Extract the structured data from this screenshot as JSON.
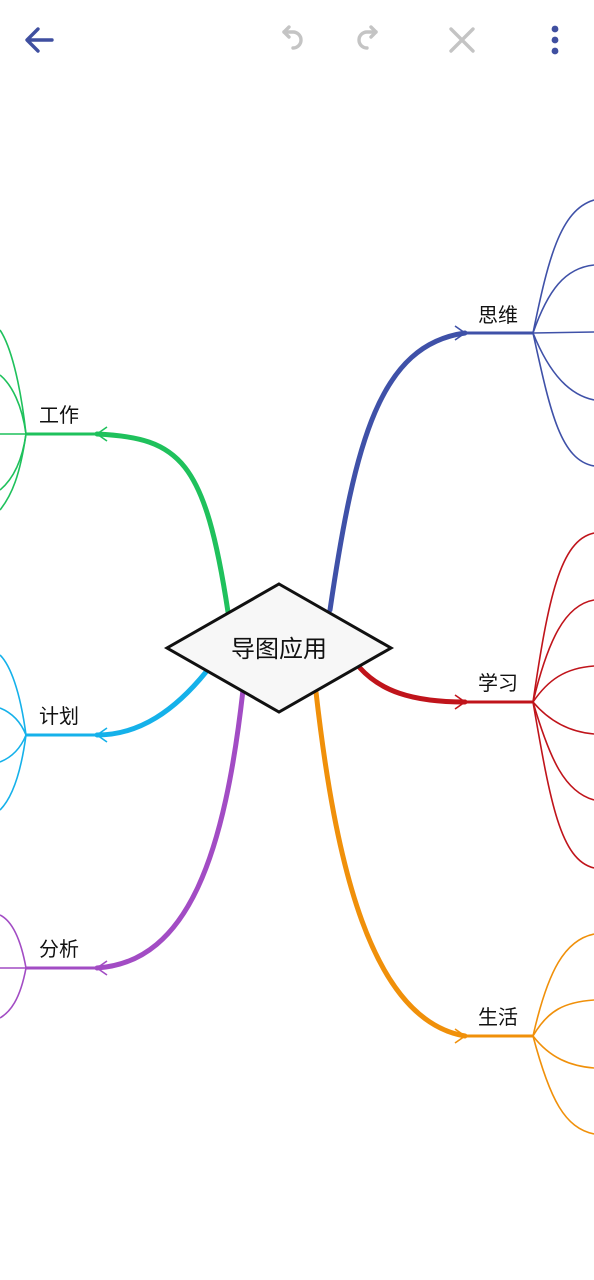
{
  "toolbar": {
    "back_icon": "arrow-left-icon",
    "undo_icon": "undo-icon",
    "redo_icon": "redo-icon",
    "close_icon": "close-icon",
    "more_icon": "more-vertical-icon"
  },
  "colors": {
    "toolbar_active": "#3f4fa0",
    "toolbar_disabled": "#c4c4c4",
    "root_fill": "#f7f7f7",
    "root_stroke": "#111111"
  },
  "mindmap": {
    "root": {
      "label": "导图应用"
    },
    "branches": [
      {
        "id": "siwei",
        "label": "思维",
        "color": "#3f51a8"
      },
      {
        "id": "xuexi",
        "label": "学习",
        "color": "#c0141b"
      },
      {
        "id": "shenghuo",
        "label": "生活",
        "color": "#f0900a"
      },
      {
        "id": "gongzuo",
        "label": "工作",
        "color": "#1fc15c"
      },
      {
        "id": "jihua",
        "label": "计划",
        "color": "#15b1ea"
      },
      {
        "id": "fenxi",
        "label": "分析",
        "color": "#a24cc4"
      }
    ]
  }
}
